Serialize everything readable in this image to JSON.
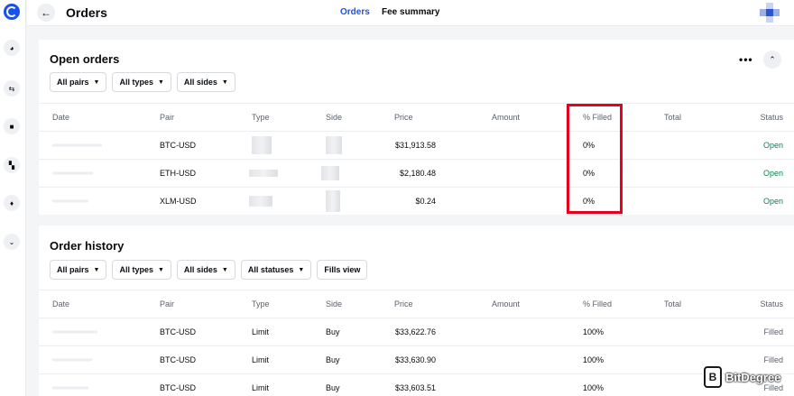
{
  "header": {
    "title": "Orders",
    "tabs": [
      {
        "label": "Orders",
        "active": true
      },
      {
        "label": "Fee summary",
        "active": false
      }
    ]
  },
  "sidebar": {
    "icons": [
      "pie-chart-icon",
      "swap-icon",
      "wallet-icon",
      "dashboard-icon",
      "bell-icon",
      "chevron-down-icon"
    ]
  },
  "open_orders": {
    "title": "Open orders",
    "more_label": "•••",
    "collapse_label": "⌃",
    "filters": [
      "All pairs",
      "All types",
      "All sides"
    ],
    "columns": [
      "Date",
      "Pair",
      "Type",
      "Side",
      "Price",
      "Amount",
      "% Filled",
      "Total",
      "Status"
    ],
    "rows": [
      {
        "pair": "BTC-USD",
        "price": "$31,913.58",
        "filled": "0%",
        "status": "Open"
      },
      {
        "pair": "ETH-USD",
        "price": "$2,180.48",
        "filled": "0%",
        "status": "Open"
      },
      {
        "pair": "XLM-USD",
        "price": "$0.24",
        "filled": "0%",
        "status": "Open"
      }
    ]
  },
  "order_history": {
    "title": "Order history",
    "filters": [
      "All pairs",
      "All types",
      "All sides",
      "All statuses"
    ],
    "fills_view": "Fills view",
    "columns": [
      "Date",
      "Pair",
      "Type",
      "Side",
      "Price",
      "Amount",
      "% Filled",
      "Total",
      "Status"
    ],
    "rows": [
      {
        "pair": "BTC-USD",
        "type": "Limit",
        "side": "Buy",
        "price": "$33,622.76",
        "filled": "100%",
        "status": "Filled"
      },
      {
        "pair": "BTC-USD",
        "type": "Limit",
        "side": "Buy",
        "price": "$33,630.90",
        "filled": "100%",
        "status": "Filled"
      },
      {
        "pair": "BTC-USD",
        "type": "Limit",
        "side": "Buy",
        "price": "$33,603.51",
        "filled": "100%",
        "status": "Filled"
      }
    ]
  },
  "watermark": {
    "text": "BitDegree",
    "badge": "B"
  },
  "colors": {
    "accent": "#1652f0",
    "open": "#098551",
    "highlight": "#e8001c",
    "muted": "#5b616e"
  }
}
